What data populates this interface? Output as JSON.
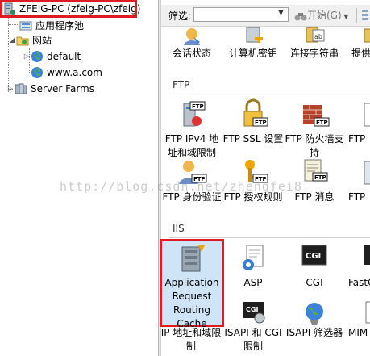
{
  "tree": {
    "server": "ZFEIG-PC (zfeig-PC\\zfeig)",
    "app_pools": "应用程序池",
    "sites": "网站",
    "site_default": "default",
    "site_a": "www.a.com",
    "server_farms": "Server Farms"
  },
  "toolbar": {
    "filter_label": "筛选:",
    "filter_value": "",
    "start_label": "开始(G)"
  },
  "top_row": [
    {
      "label": "会话状态",
      "icon": "session-state-icon"
    },
    {
      "label": "计算机密钥",
      "icon": "machine-key-icon"
    },
    {
      "label": "连接字符串",
      "icon": "connection-strings-icon"
    },
    {
      "label": "提供",
      "icon": "providers-icon"
    }
  ],
  "ftp": {
    "header": "FTP",
    "row1": [
      {
        "label": "FTP IPv4 地址和域限制",
        "icon": "ftp-ipv4-icon"
      },
      {
        "label": "FTP SSL 设置",
        "icon": "ftp-ssl-icon"
      },
      {
        "label": "FTP 防火墙支持",
        "icon": "ftp-firewall-icon"
      },
      {
        "label": "FTP",
        "icon": "ftp-more-icon"
      }
    ],
    "row2": [
      {
        "label": "FTP 身份验证",
        "icon": "ftp-auth-icon"
      },
      {
        "label": "FTP 授权规则",
        "icon": "ftp-authz-icon"
      },
      {
        "label": "FTP 消息",
        "icon": "ftp-messages-icon"
      },
      {
        "label": "FTP",
        "icon": "ftp-more2-icon"
      }
    ]
  },
  "iis": {
    "header": "IIS",
    "row1": [
      {
        "label": "Application Request Routing Cache",
        "icon": "arr-cache-icon"
      },
      {
        "label": "ASP",
        "icon": "asp-icon"
      },
      {
        "label": "CGI",
        "icon": "cgi-icon"
      },
      {
        "label": "FastC",
        "icon": "fastcgi-icon"
      }
    ],
    "row2": [
      {
        "label": "IP 地址和域限制",
        "icon": "ip-restrict-icon"
      },
      {
        "label": "ISAPI 和 CGI 限制",
        "icon": "isapi-cgi-icon"
      },
      {
        "label": "ISAPI 筛选器",
        "icon": "isapi-filter-icon"
      },
      {
        "label": "MIM",
        "icon": "mime-icon"
      }
    ]
  },
  "watermark": "http://blog.csdn.net/zhengfei8"
}
